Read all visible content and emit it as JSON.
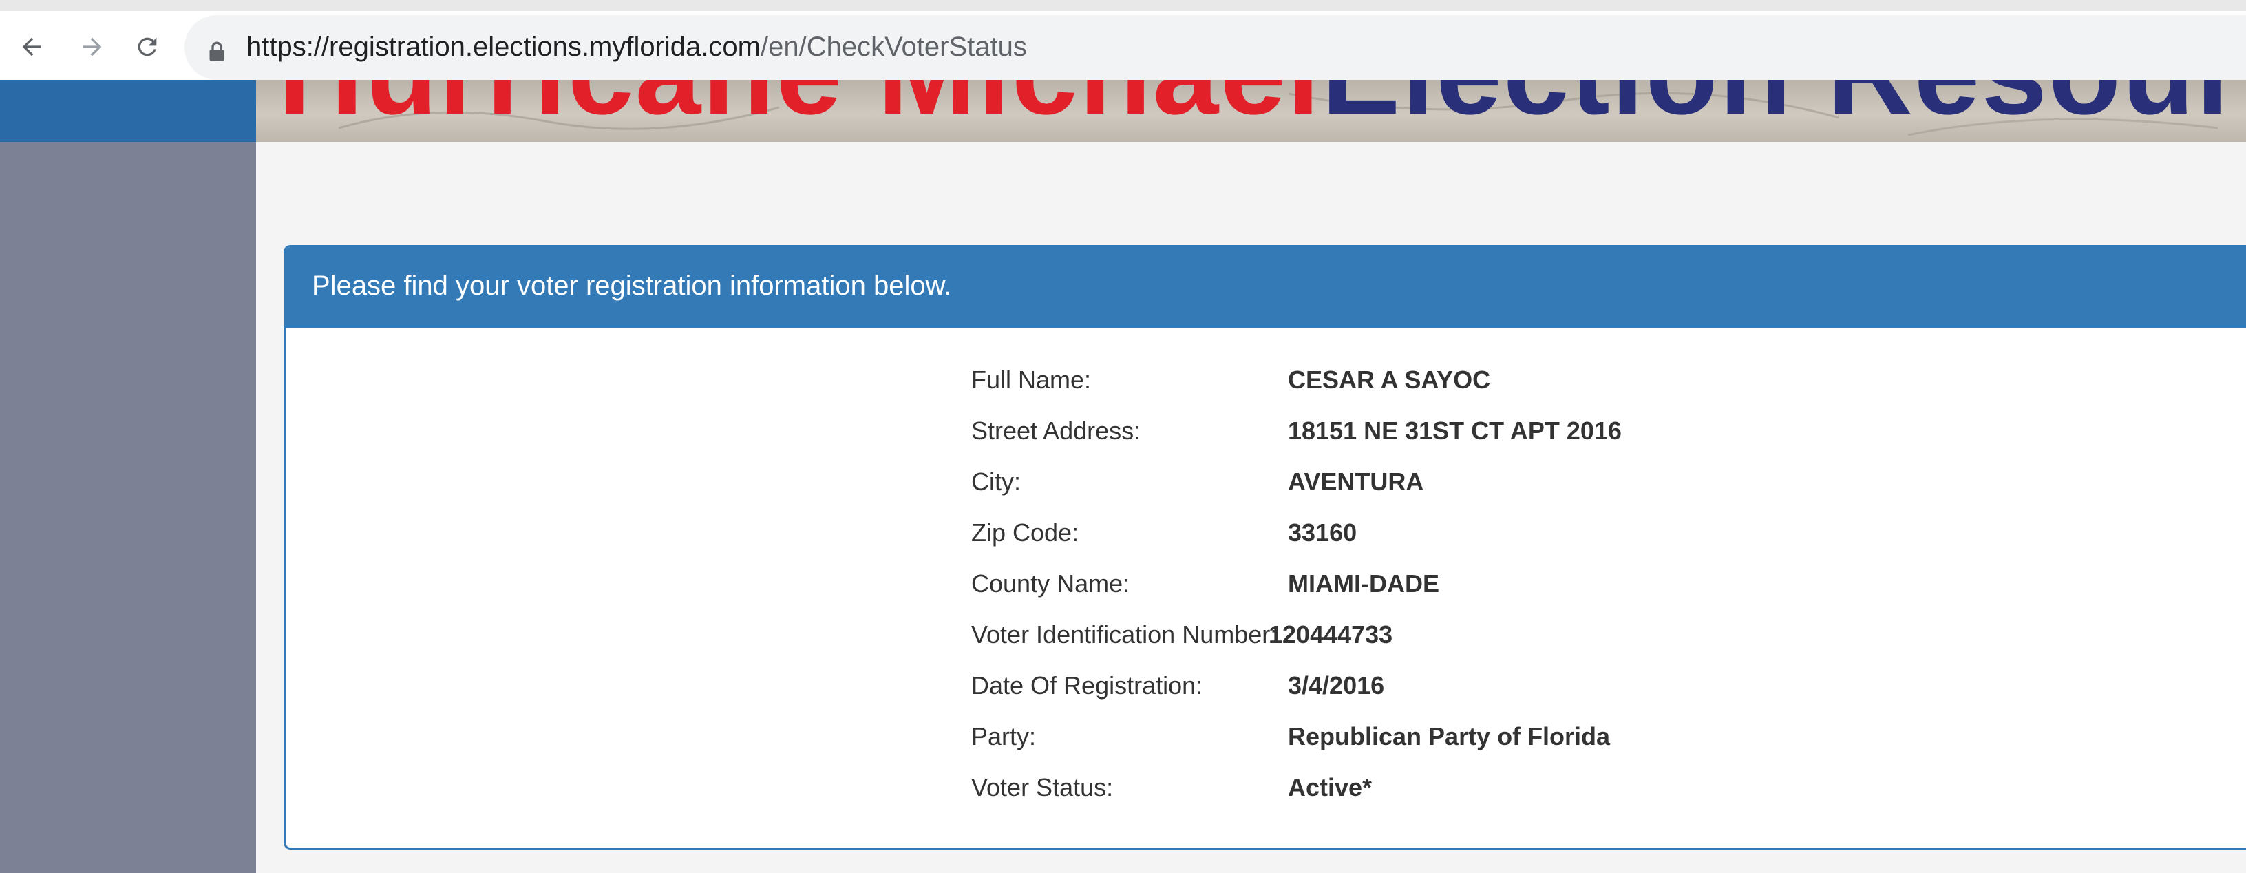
{
  "browser": {
    "url_host": "https://registration.elections.myflorida.com",
    "url_path": "/en/CheckVoterStatus"
  },
  "banner": {
    "text_red": "Hurricane Michael",
    "text_navy": "Election Resource"
  },
  "panel": {
    "heading": "Please find your voter registration information below.",
    "fields": [
      {
        "label": "Full Name:",
        "value": "CESAR A SAYOC"
      },
      {
        "label": "Street Address:",
        "value": "18151 NE 31ST CT APT 2016"
      },
      {
        "label": "City:",
        "value": "AVENTURA"
      },
      {
        "label": "Zip Code:",
        "value": "33160"
      },
      {
        "label": "County Name:",
        "value": "MIAMI-DADE"
      },
      {
        "label": "Voter Identification Number:",
        "value": "120444733"
      },
      {
        "label": "Date Of Registration:",
        "value": "3/4/2016"
      },
      {
        "label": "Party:",
        "value": "Republican Party of Florida"
      },
      {
        "label": "Voter Status:",
        "value": "Active*"
      }
    ]
  },
  "colors": {
    "header_blue": "#337ab7",
    "sidebar_gray": "#7d8196",
    "banner_red": "#e2202a",
    "banner_navy": "#2a2f7a"
  },
  "icons": [
    "back-arrow-icon",
    "forward-arrow-icon",
    "reload-icon",
    "lock-icon"
  ]
}
